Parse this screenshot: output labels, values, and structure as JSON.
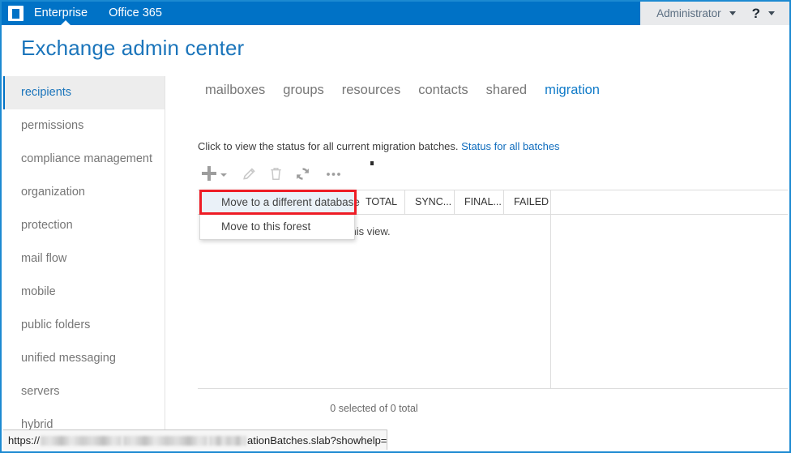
{
  "suite_bar": {
    "app_launcher_icon": "office-waffle-icon",
    "enterprise_label": "Enterprise",
    "office365_label": "Office 365",
    "account_label": "Administrator",
    "account_caret_icon": "chevron-down-icon",
    "help_glyph": "?",
    "help_caret_icon": "chevron-down-icon",
    "brand_color": "#0072c6",
    "right_bg_color": "#e9eaec"
  },
  "page": {
    "title": "Exchange admin center",
    "title_color": "#1b75bb"
  },
  "sidebar": {
    "items": [
      {
        "label": "recipients",
        "selected": true
      },
      {
        "label": "permissions",
        "selected": false
      },
      {
        "label": "compliance management",
        "selected": false
      },
      {
        "label": "organization",
        "selected": false
      },
      {
        "label": "protection",
        "selected": false
      },
      {
        "label": "mail flow",
        "selected": false
      },
      {
        "label": "mobile",
        "selected": false
      },
      {
        "label": "public folders",
        "selected": false
      },
      {
        "label": "unified messaging",
        "selected": false
      },
      {
        "label": "servers",
        "selected": false
      },
      {
        "label": "hybrid",
        "selected": false
      }
    ],
    "selected_color": "#1b75bb",
    "selected_bg": "#ededed"
  },
  "tabs": [
    {
      "label": "mailboxes",
      "active": false
    },
    {
      "label": "groups",
      "active": false
    },
    {
      "label": "resources",
      "active": false
    },
    {
      "label": "contacts",
      "active": false
    },
    {
      "label": "shared",
      "active": false
    },
    {
      "label": "migration",
      "active": true
    }
  ],
  "hint": {
    "text": "Click to view the status for all current migration batches.",
    "link_label": "Status for all batches"
  },
  "toolbar": {
    "new_icon": "plus-icon",
    "new_caret_icon": "chevron-down-icon",
    "edit_icon": "pencil-icon",
    "delete_icon": "trash-icon",
    "refresh_icon": "refresh-icon",
    "more_icon": "ellipsis-icon"
  },
  "dropdown": {
    "items": [
      {
        "label": "Move to a different database",
        "hovered": true
      },
      {
        "label": "Move to this forest",
        "hovered": false
      }
    ],
    "highlight_border_color": "#ee1c25",
    "hover_bg": "#eaf1f8"
  },
  "grid": {
    "columns": [
      "",
      "TOTAL",
      "SYNC...",
      "FINAL...",
      "FAILED"
    ],
    "rows": [],
    "empty_message": "There are no items to show in this view.",
    "footer": "0 selected of 0 total"
  },
  "status_bar": {
    "url_prefix": "https://",
    "url_suffix": "ationBatches.slab?showhelp=false#"
  }
}
